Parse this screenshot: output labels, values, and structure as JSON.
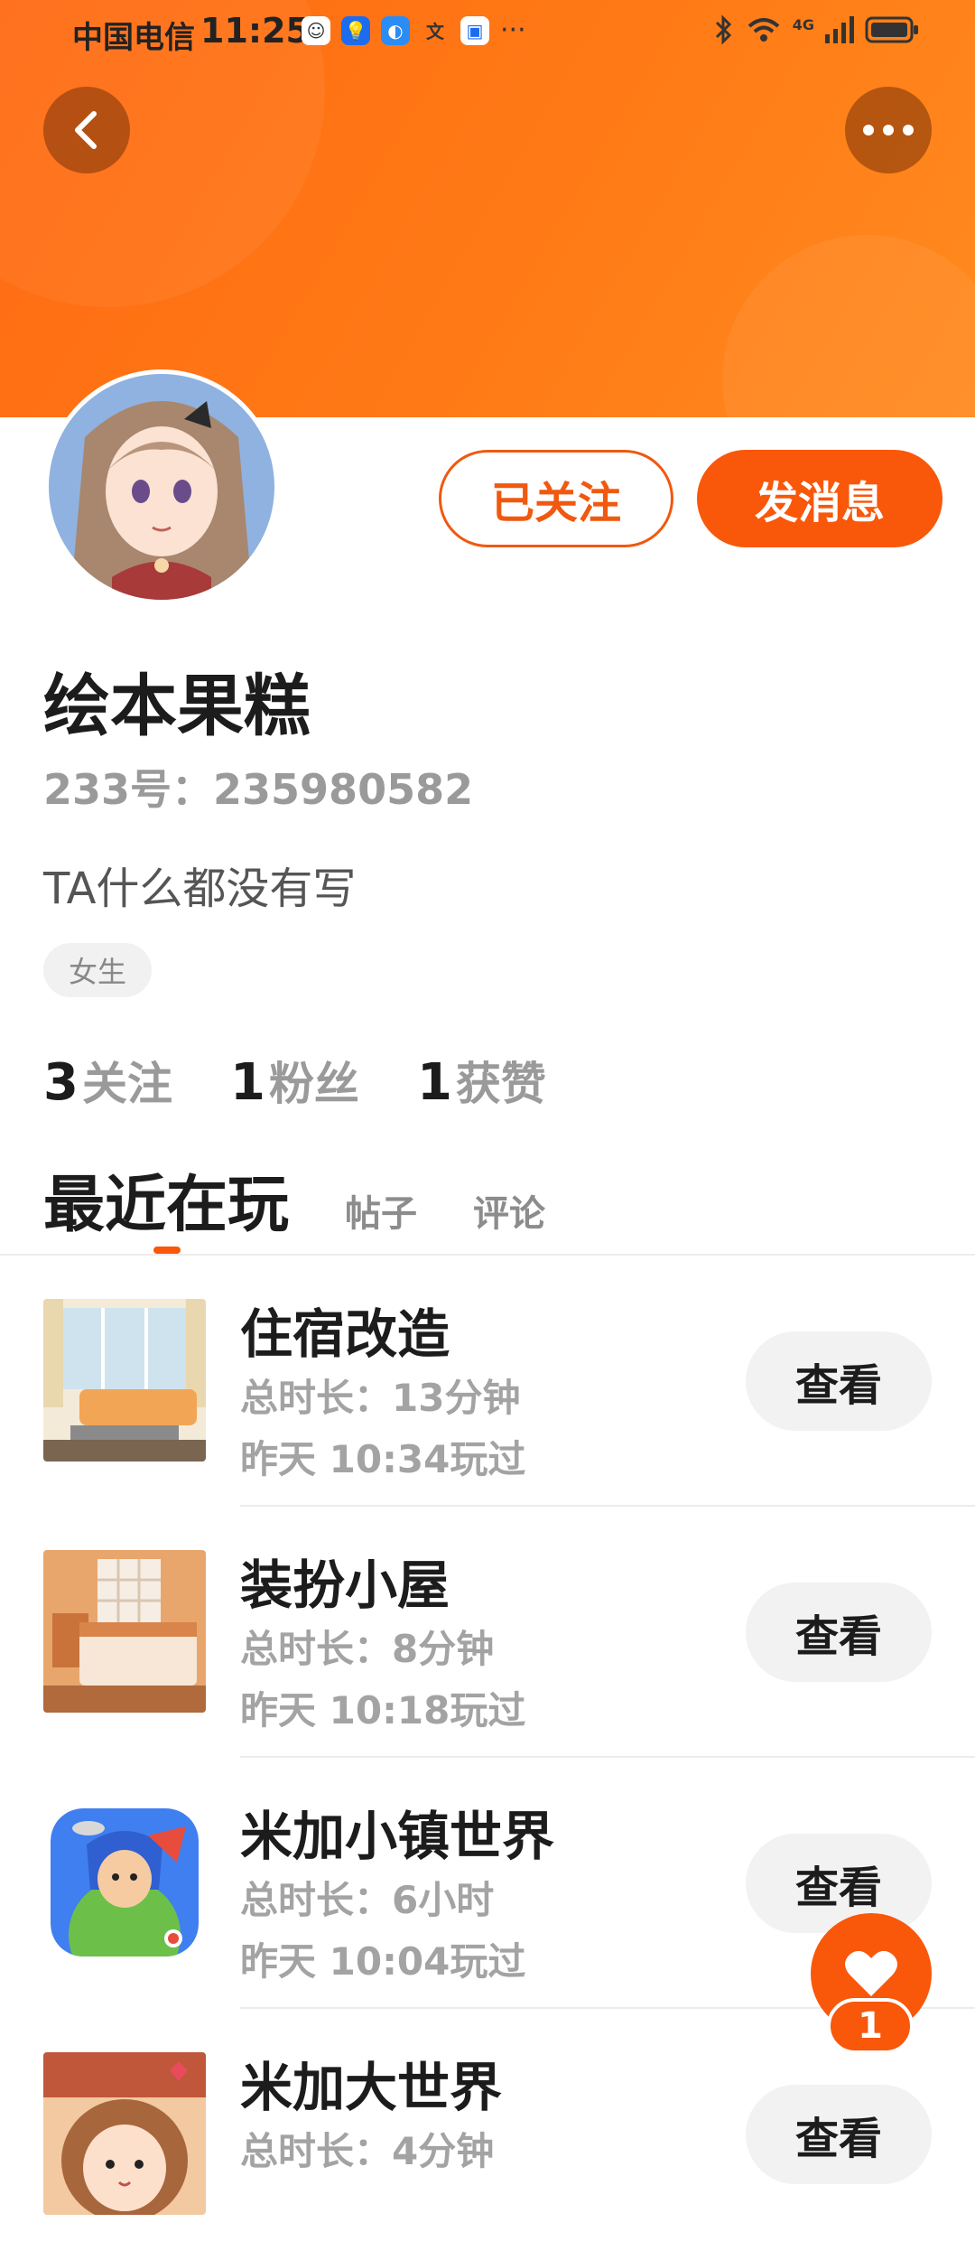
{
  "status_bar": {
    "carrier": "中国电信",
    "time": "11:25",
    "network": "4G"
  },
  "profile": {
    "follow_state_label": "已关注",
    "message_label": "发消息",
    "nickname": "绘本果糕",
    "id_label": "233号：",
    "id_value": "235980582",
    "bio": "TA什么都没有写",
    "gender_tag": "女生"
  },
  "stats": [
    {
      "value": "3",
      "label": "关注"
    },
    {
      "value": "1",
      "label": "粉丝"
    },
    {
      "value": "1",
      "label": "获赞"
    }
  ],
  "tabs": [
    {
      "label": "最近在玩",
      "active": true
    },
    {
      "label": "帖子",
      "active": false
    },
    {
      "label": "评论",
      "active": false
    }
  ],
  "games": [
    {
      "name": "住宿改造",
      "duration": "总时长：13分钟",
      "last_played": "昨天 10:34玩过",
      "action": "查看",
      "thumb": "living-room"
    },
    {
      "name": "装扮小屋",
      "duration": "总时长：8分钟",
      "last_played": "昨天 10:18玩过",
      "action": "查看",
      "thumb": "bedroom"
    },
    {
      "name": "米加小镇世界",
      "duration": "总时长：6小时",
      "last_played": "昨天 10:04玩过",
      "action": "查看",
      "thumb": "toca-app-icon"
    },
    {
      "name": "米加大世界",
      "duration": "总时长：4分钟",
      "last_played": "",
      "action": "查看",
      "thumb": "cartoon-girl"
    }
  ],
  "fab": {
    "count": "1"
  },
  "colors": {
    "accent": "#f9570a",
    "header": "#ff7416"
  }
}
